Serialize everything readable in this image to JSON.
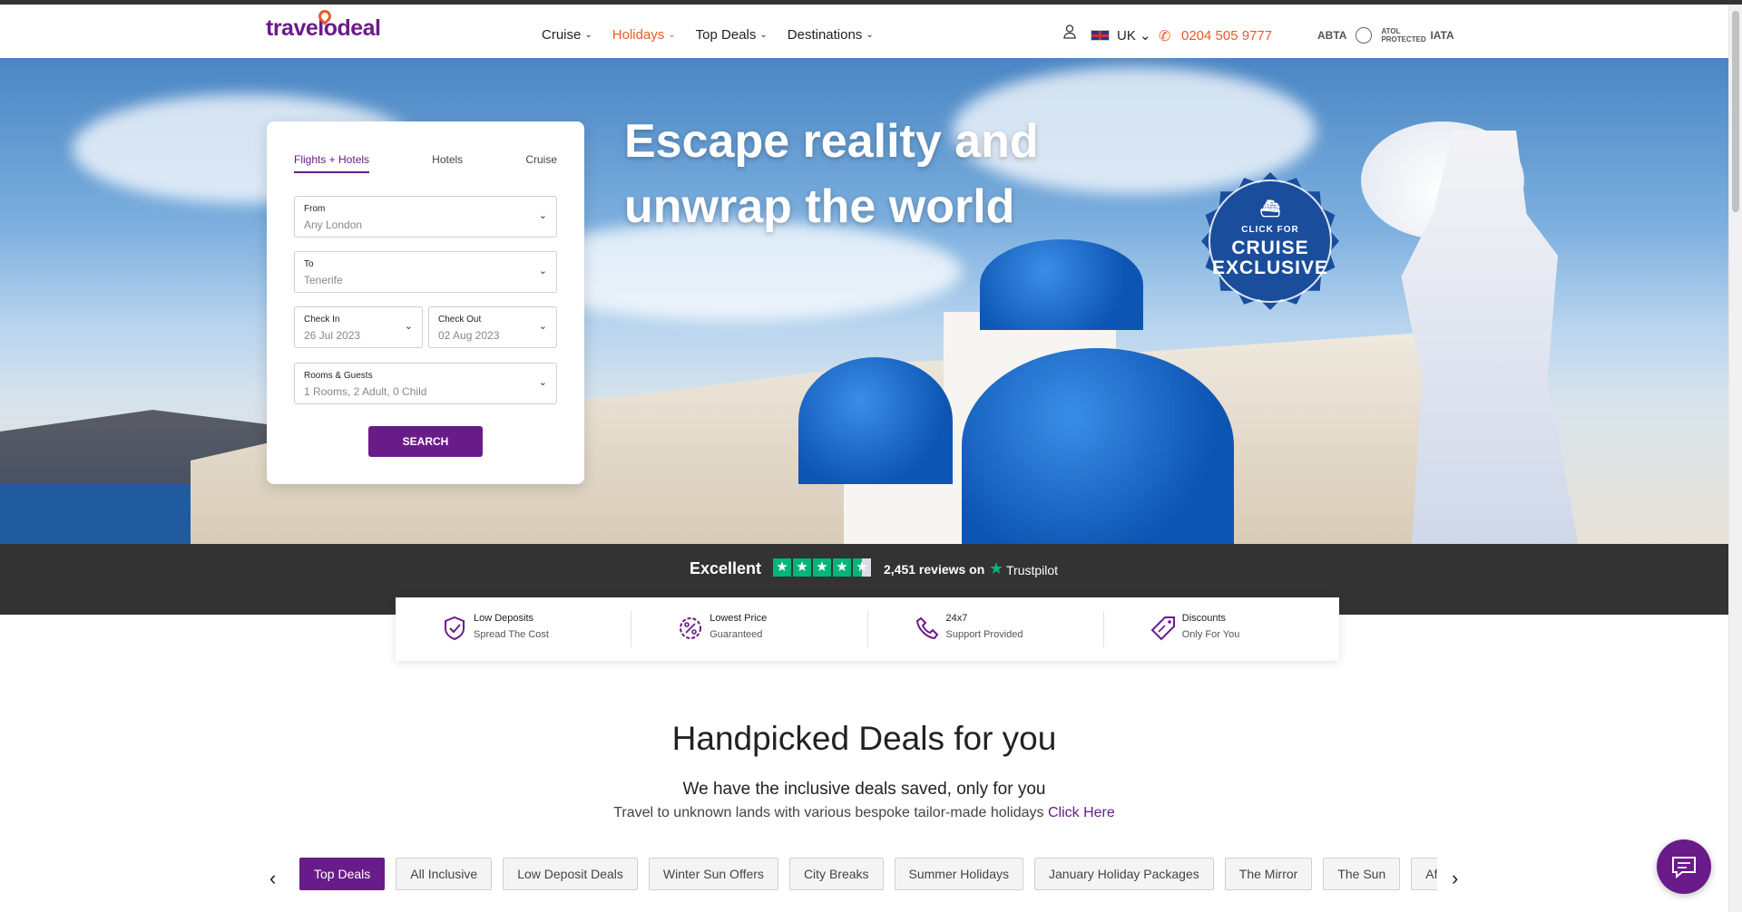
{
  "header": {
    "logo": "travelodeal",
    "nav": [
      {
        "label": "Cruise",
        "active": false
      },
      {
        "label": "Holidays",
        "active": true
      },
      {
        "label": "Top Deals",
        "active": false
      },
      {
        "label": "Destinations",
        "active": false
      }
    ],
    "country": "UK",
    "phone": "0204 505 9777",
    "accreditations": [
      "ABTA",
      "ATOL PROTECTED",
      "IATA"
    ]
  },
  "hero": {
    "title_line1": "Escape reality and",
    "title_line2": "unwrap the world",
    "badge": {
      "small": "CLICK FOR",
      "line1": "CRUISE",
      "line2": "EXCLUSIVE"
    }
  },
  "search": {
    "tabs": [
      {
        "label": "Flights + Hotels",
        "active": true
      },
      {
        "label": "Hotels",
        "active": false
      },
      {
        "label": "Cruise",
        "active": false
      }
    ],
    "from": {
      "label": "From",
      "value": "Any London"
    },
    "to": {
      "label": "To",
      "value": "Tenerife"
    },
    "checkin": {
      "label": "Check In",
      "value": "26 Jul 2023"
    },
    "checkout": {
      "label": "Check Out",
      "value": "02 Aug 2023"
    },
    "rooms": {
      "label": "Rooms & Guests",
      "value": "1 Rooms, 2 Adult, 0 Child"
    },
    "button": "SEARCH"
  },
  "trust": {
    "rating_word": "Excellent",
    "stars": 4.5,
    "reviews": "2,451 reviews on",
    "brand": "Trustpilot",
    "brand_color": "#00b67a"
  },
  "features": [
    {
      "icon": "shield-check-icon",
      "title": "Low Deposits",
      "subtitle": "Spread The Cost"
    },
    {
      "icon": "percent-badge-icon",
      "title": "Lowest Price",
      "subtitle": "Guaranteed"
    },
    {
      "icon": "phone-icon",
      "title": "24x7",
      "subtitle": "Support Provided"
    },
    {
      "icon": "discount-tag-icon",
      "title": "Discounts",
      "subtitle": "Only For You"
    }
  ],
  "deals": {
    "title": "Handpicked Deals for you",
    "subtitle": "We have the inclusive deals saved, only for you",
    "subtitle2": "Travel to unknown lands with various bespoke tailor-made holidays",
    "link": "Click Here",
    "chips": [
      "Top Deals",
      "All Inclusive",
      "Low Deposit Deals",
      "Winter Sun Offers",
      "City Breaks",
      "Summer Holidays",
      "January Holiday Packages",
      "The Mirror",
      "The Sun",
      "Affordabl"
    ],
    "active_chip": 0
  },
  "colors": {
    "brand": "#6a1b8a",
    "accent": "#e95b27"
  }
}
